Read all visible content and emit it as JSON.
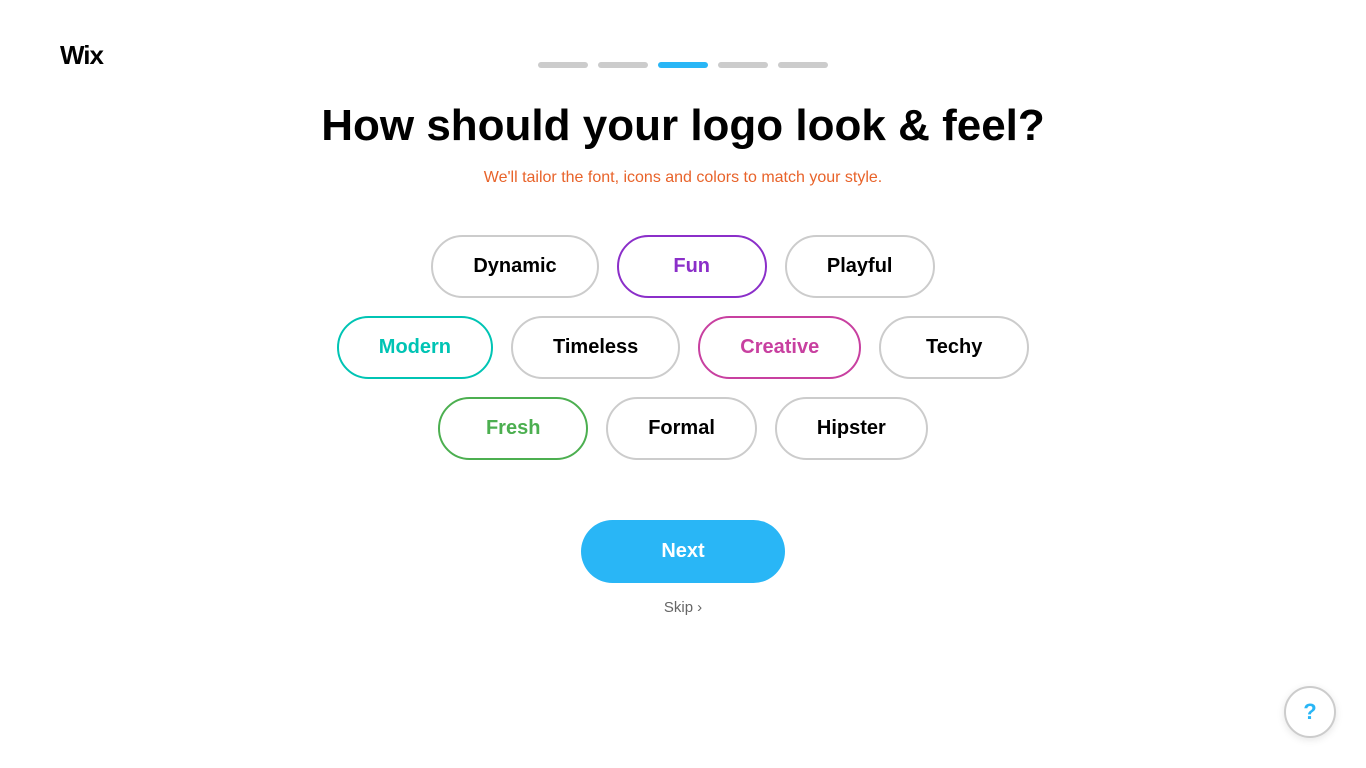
{
  "logo": {
    "text": "Wix"
  },
  "progress": {
    "steps": [
      {
        "id": 1,
        "color": "#ccc"
      },
      {
        "id": 2,
        "color": "#ccc"
      },
      {
        "id": 3,
        "color": "#29B6F6"
      },
      {
        "id": 4,
        "color": "#ccc"
      },
      {
        "id": 5,
        "color": "#ccc"
      }
    ]
  },
  "header": {
    "title": "How should your logo look & feel?",
    "subtitle": "We'll tailor the font, icons and colors to match your style."
  },
  "options": {
    "rows": [
      {
        "items": [
          {
            "label": "Dynamic",
            "selected": false,
            "selectedClass": ""
          },
          {
            "label": "Fun",
            "selected": true,
            "selectedClass": "selected-fun"
          },
          {
            "label": "Playful",
            "selected": false,
            "selectedClass": ""
          }
        ]
      },
      {
        "items": [
          {
            "label": "Modern",
            "selected": true,
            "selectedClass": "selected-modern"
          },
          {
            "label": "Timeless",
            "selected": false,
            "selectedClass": ""
          },
          {
            "label": "Creative",
            "selected": true,
            "selectedClass": "selected-creative"
          },
          {
            "label": "Techy",
            "selected": false,
            "selectedClass": ""
          }
        ]
      },
      {
        "items": [
          {
            "label": "Fresh",
            "selected": true,
            "selectedClass": "selected-fresh"
          },
          {
            "label": "Formal",
            "selected": false,
            "selectedClass": ""
          },
          {
            "label": "Hipster",
            "selected": false,
            "selectedClass": ""
          }
        ]
      }
    ]
  },
  "buttons": {
    "next": "Next",
    "skip": "Skip",
    "help": "?"
  }
}
